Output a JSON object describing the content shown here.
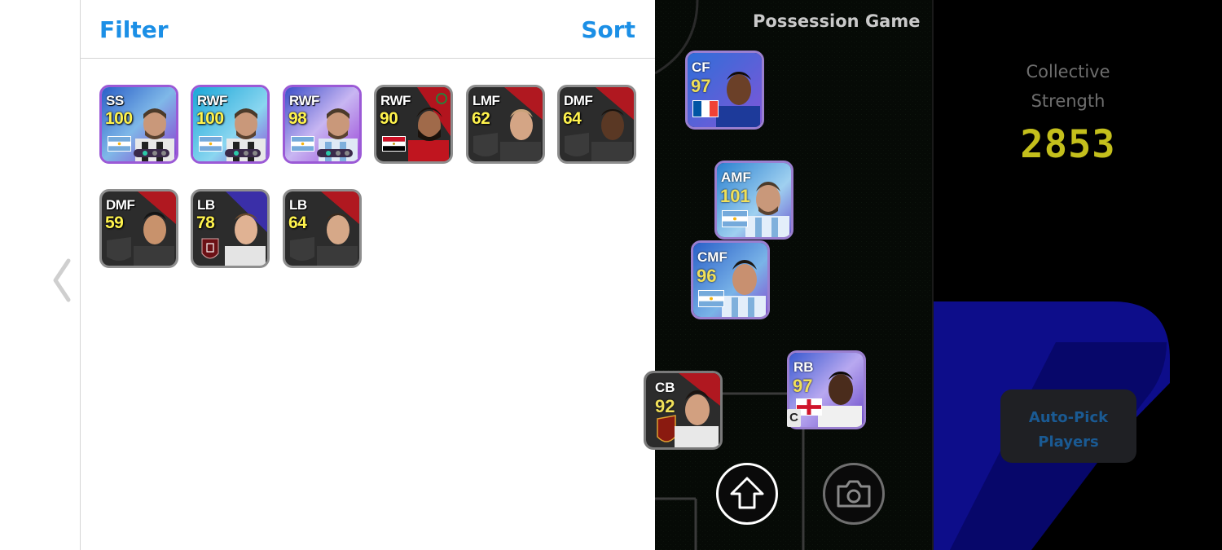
{
  "panel": {
    "filter_label": "Filter",
    "sort_label": "Sort"
  },
  "cards": [
    {
      "position": "SS",
      "rating": "100",
      "flag": "argentina"
    },
    {
      "position": "RWF",
      "rating": "100",
      "flag": "argentina"
    },
    {
      "position": "RWF",
      "rating": "98",
      "flag": "argentina"
    },
    {
      "position": "RWF",
      "rating": "90",
      "flag": "egypt"
    },
    {
      "position": "LMF",
      "rating": "62",
      "flag": "none"
    },
    {
      "position": "DMF",
      "rating": "64",
      "flag": "none"
    },
    {
      "position": "DMF",
      "rating": "59",
      "flag": "none"
    },
    {
      "position": "LB",
      "rating": "78",
      "flag": "club-emblem"
    },
    {
      "position": "LB",
      "rating": "64",
      "flag": "none"
    }
  ],
  "pitch": {
    "title": "Possession Game",
    "players": [
      {
        "position": "CF",
        "rating": "97",
        "flag": "france"
      },
      {
        "position": "AMF",
        "rating": "101",
        "flag": "argentina"
      },
      {
        "position": "CMF",
        "rating": "96",
        "flag": "argentina"
      },
      {
        "position": "RB",
        "rating": "97",
        "flag": "england"
      },
      {
        "position": "CB",
        "rating": "92",
        "flag": "club-emblem"
      }
    ],
    "captain_label": "C"
  },
  "side": {
    "collective_line1": "Collective",
    "collective_line2": "Strength",
    "collective_value": "2853",
    "auto_pick_line1": "Auto-Pick",
    "auto_pick_line2": "Players"
  },
  "icons": {
    "back": "chevron-left-icon",
    "upload": "arrow-up-icon",
    "camera": "camera-icon"
  },
  "colors": {
    "accent": "#1b8fe6",
    "rating": "#fff34d",
    "collective_value": "#c4bf1c"
  }
}
